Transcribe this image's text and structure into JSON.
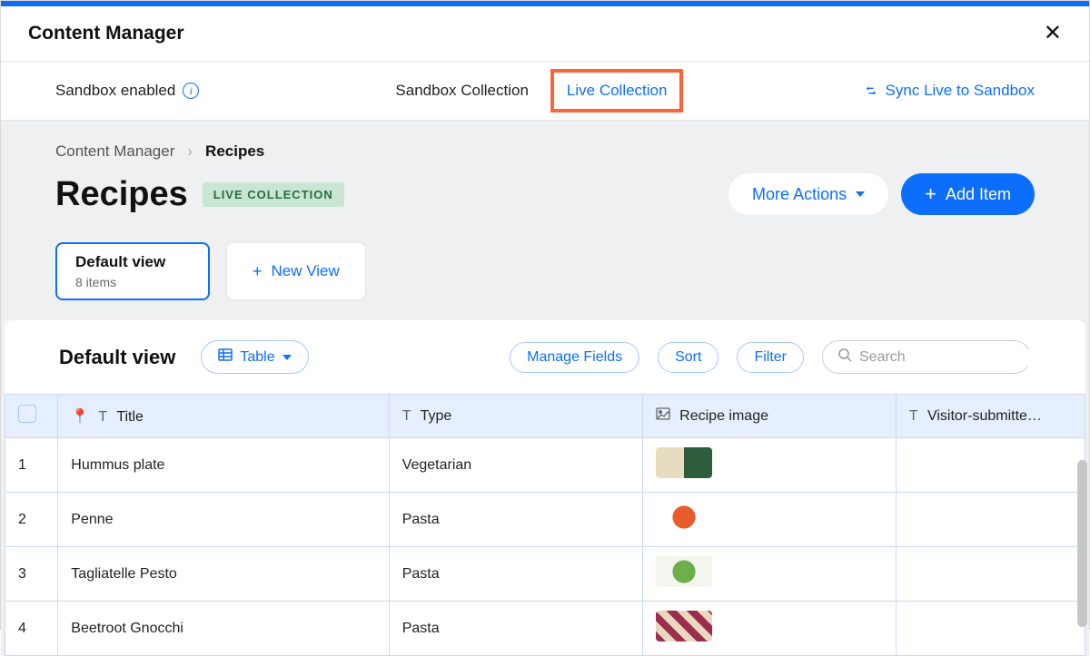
{
  "header": {
    "title": "Content Manager"
  },
  "toolbar": {
    "sandbox_status": "Sandbox enabled",
    "tab_sandbox": "Sandbox Collection",
    "tab_live": "Live Collection",
    "sync_label": "Sync Live to Sandbox"
  },
  "breadcrumb": {
    "root": "Content Manager",
    "current": "Recipes"
  },
  "page": {
    "title": "Recipes",
    "badge": "LIVE COLLECTION",
    "more_actions": "More Actions",
    "add_item": "Add Item"
  },
  "views": {
    "default_name": "Default view",
    "default_count": "8 items",
    "new_view": "New View"
  },
  "table_controls": {
    "view_title": "Default view",
    "mode_label": "Table",
    "manage_fields": "Manage Fields",
    "sort": "Sort",
    "filter": "Filter",
    "search_placeholder": "Search"
  },
  "columns": {
    "title": "Title",
    "type": "Type",
    "image": "Recipe image",
    "visitor": "Visitor-submitte…"
  },
  "rows": [
    {
      "n": "1",
      "title": "Hummus plate",
      "type": "Vegetarian",
      "img": "hummus"
    },
    {
      "n": "2",
      "title": "Penne",
      "type": "Pasta",
      "img": "penne"
    },
    {
      "n": "3",
      "title": "Tagliatelle Pesto",
      "type": "Pasta",
      "img": "pesto"
    },
    {
      "n": "4",
      "title": "Beetroot Gnocchi",
      "type": "Pasta",
      "img": "beetroot"
    }
  ]
}
